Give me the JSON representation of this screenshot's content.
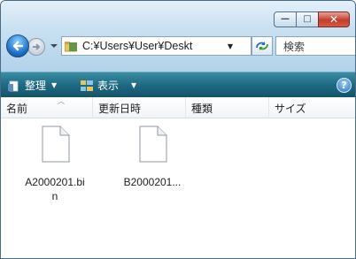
{
  "window": {
    "caption_buttons": [
      {
        "name": "minimize",
        "glyph": "—"
      },
      {
        "name": "maximize",
        "glyph": "□"
      },
      {
        "name": "close",
        "glyph": "✕"
      }
    ],
    "colors": {
      "close": "#c33d2b",
      "commandbar": "#1f6a83",
      "frame": "#b8d4e8"
    }
  },
  "nav": {
    "address_path": "C:¥Users¥User¥Deskt",
    "search_placeholder": "検索",
    "icons": {
      "back": "back-arrow-icon",
      "forward": "forward-arrow-icon",
      "refresh": "refresh-icon",
      "folder": "folder-icon"
    }
  },
  "commandbar": {
    "organize_label": "整理",
    "views_label": "表示",
    "help_label": "?"
  },
  "columns": [
    {
      "label": "名前"
    },
    {
      "label": "更新日時"
    },
    {
      "label": "種類"
    },
    {
      "label": "サイズ"
    }
  ],
  "files": [
    {
      "name": "A2000201.bin",
      "display_line1": "A2000201.bi",
      "display_line2": "n"
    },
    {
      "name": "B2000201...",
      "display_line1": "B2000201...",
      "display_line2": ""
    }
  ]
}
